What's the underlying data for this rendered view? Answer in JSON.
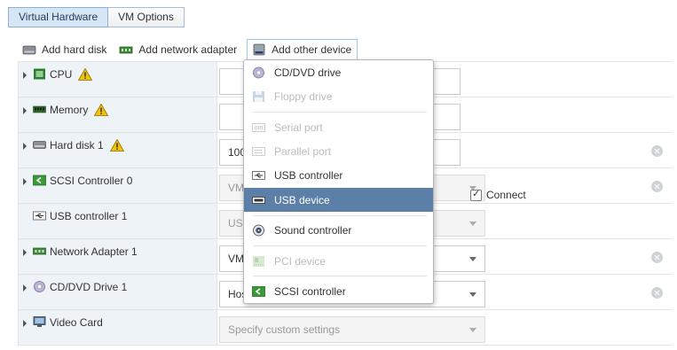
{
  "tabs": [
    {
      "label": "Virtual Hardware",
      "active": true
    },
    {
      "label": "VM Options",
      "active": false
    }
  ],
  "toolbar": {
    "add_hard_disk": "Add hard disk",
    "add_network_adapter": "Add network adapter",
    "add_other_device": "Add other device"
  },
  "devices": [
    {
      "label": "CPU",
      "icon": "cpu-icon",
      "warning": true,
      "field": "",
      "field_disabled": false
    },
    {
      "label": "Memory",
      "icon": "memory-icon",
      "warning": true,
      "field": "",
      "field_disabled": false
    },
    {
      "label": "Hard disk 1",
      "icon": "hard-disk-icon",
      "warning": true,
      "field": "100",
      "field_disabled": false
    },
    {
      "label": "SCSI Controller 0",
      "icon": "scsi-controller-icon",
      "warning": false,
      "field": "VM",
      "field_disabled": true
    },
    {
      "label": "USB controller 1",
      "icon": "usb-icon",
      "warning": false,
      "field": "US",
      "field_disabled": true
    },
    {
      "label": "Network Adapter 1",
      "icon": "network-adapter-icon",
      "warning": false,
      "field": "VM",
      "field_disabled": false
    },
    {
      "label": "CD/DVD Drive 1",
      "icon": "cd-dvd-icon",
      "warning": false,
      "field": "Hos",
      "field_disabled": false
    },
    {
      "label": "Video Card",
      "icon": "video-card-icon",
      "warning": false,
      "field": "Specify custom settings",
      "field_disabled": true
    }
  ],
  "network_connect_label": "Connect",
  "menu": {
    "items": [
      {
        "label": "CD/DVD drive",
        "icon": "cd-dvd-icon",
        "disabled": false,
        "selected": false
      },
      {
        "label": "Floppy drive",
        "icon": "floppy-icon",
        "disabled": true,
        "selected": false
      },
      {
        "label": "Serial port",
        "icon": "serial-port-icon",
        "disabled": true,
        "selected": false
      },
      {
        "label": "Parallel port",
        "icon": "parallel-port-icon",
        "disabled": true,
        "selected": false
      },
      {
        "label": "USB controller",
        "icon": "usb-icon",
        "disabled": false,
        "selected": false
      },
      {
        "label": "USB device",
        "icon": "usb-device-icon",
        "disabled": false,
        "selected": true
      },
      {
        "label": "Sound controller",
        "icon": "sound-icon",
        "disabled": false,
        "selected": false
      },
      {
        "label": "PCI device",
        "icon": "pci-icon",
        "disabled": true,
        "selected": false
      },
      {
        "label": "SCSI controller",
        "icon": "scsi-controller-icon",
        "disabled": false,
        "selected": false
      }
    ]
  },
  "colors": {
    "menu_selected": "#5b7fa6",
    "active_tab": "#d7e6f5",
    "label_column": "#eef3f8",
    "warning": "#f5c400"
  }
}
